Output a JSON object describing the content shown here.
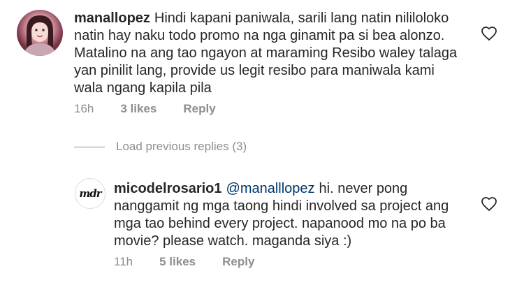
{
  "comments": [
    {
      "username": "manallopez",
      "mention": "",
      "body_lines": [
        "Hindi kapani paniwala, sarili lang natin nililoloko",
        "natin hay naku todo promo na nga ginamit pa si bea alonzo.",
        "Matalino na ang tao ngayon at maraming Resibo waley talaga",
        "yan pinilit lang, provide us legit resibo para maniwala kami",
        "wala ngang kapila pila"
      ],
      "time": "16h",
      "likes": "3 likes",
      "reply_label": "Reply",
      "avatar_icon": "profile-photo"
    },
    {
      "username": "micodelrosario1",
      "mention": "@manalllopez",
      "first_line_rest": "hi. never pong",
      "body_lines": [
        "nanggamit ng mga taong hindi involved sa project ang",
        "mga tao behind every project. napanood mo na po ba",
        "movie? please watch. maganda siya :)"
      ],
      "time": "11h",
      "likes": "5 likes",
      "reply_label": "Reply",
      "avatar_text": "mdr"
    }
  ],
  "load_previous": "Load previous replies (3)",
  "heart_icon": "heart-outline-icon",
  "colors": {
    "text": "#262626",
    "meta": "#8e8e8e",
    "mention": "#00376b"
  }
}
